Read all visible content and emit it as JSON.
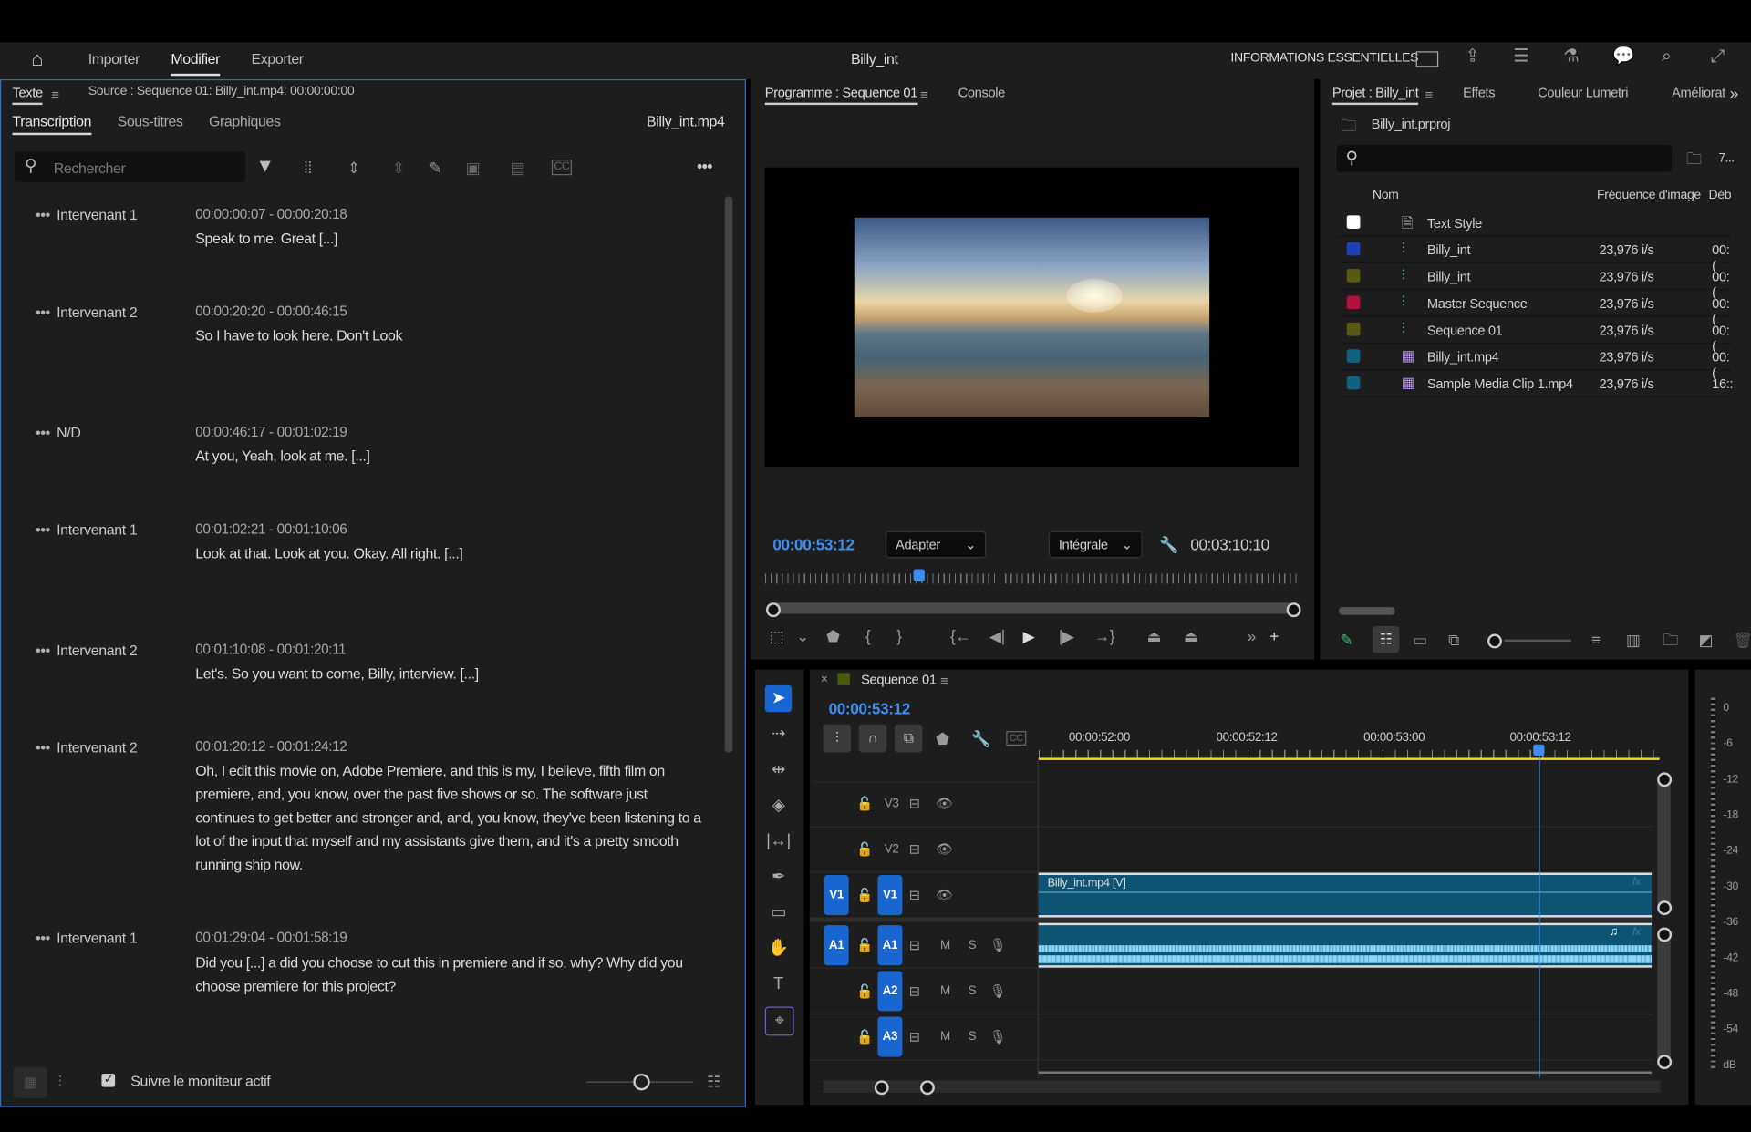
{
  "menu": {
    "items": [
      "Importer",
      "Modifier",
      "Exporter"
    ],
    "active": "Modifier",
    "title": "Billy_int",
    "workspace": "INFORMATIONS ESSENTIELLES"
  },
  "text_panel": {
    "title": "Texte",
    "source": "Source : Sequence 01: Billy_int.mp4: 00:00:00:00",
    "tabs": [
      "Transcription",
      "Sous-titres",
      "Graphiques"
    ],
    "clip": "Billy_int.mp4",
    "search_placeholder": "Rechercher",
    "follow_label": "Suivre le moniteur actif",
    "follow_checked": true,
    "entries": [
      {
        "speaker": "Intervenant 1",
        "time": "00:00:00:07 - 00:00:20:18",
        "text": "Speak to me. Great [...]"
      },
      {
        "speaker": "Intervenant 2",
        "time": "00:00:20:20 - 00:00:46:15",
        "text": "So I have to look here. Don't Look"
      },
      {
        "speaker": "N/D",
        "time": "00:00:46:17 - 00:01:02:19",
        "text": "At you, Yeah, look at me. [...]"
      },
      {
        "speaker": "Intervenant 1",
        "time": "00:01:02:21 - 00:01:10:06",
        "text": "Look at that. Look at you. Okay. All right. [...]"
      },
      {
        "speaker": "Intervenant 2",
        "time": "00:01:10:08 - 00:01:20:11",
        "text": "Let's. So you want to come, Billy, interview. [...]"
      },
      {
        "speaker": "Intervenant 2",
        "time": "00:01:20:12 - 00:01:24:12",
        "text": "Oh, I edit this movie on, Adobe Premiere, and this is my, I believe, fifth film on premiere, and, you know, over the past five shows or so. The software just continues to get better and stronger and, and, you know, they've been listening to a lot of the input that myself and my assistants give them, and it's a pretty smooth running ship now."
      },
      {
        "speaker": "Intervenant 1",
        "time": "00:01:29:04 - 00:01:58:19",
        "text": "Did you [...] a did you choose to cut this in premiere and if so, why? Why did you choose premiere for this project?"
      }
    ]
  },
  "program": {
    "tabs": [
      "Programme : Sequence 01",
      "Console"
    ],
    "timecode": "00:00:53:12",
    "fit": "Adapter",
    "quality": "Intégrale",
    "duration": "00:03:10:10",
    "playhead_fraction": 0.28
  },
  "project": {
    "tabs": [
      "Projet : Billy_int",
      "Effets",
      "Couleur Lumetri",
      "Améliorat"
    ],
    "file": "Billy_int.prproj",
    "count": "7...",
    "columns": [
      "Nom",
      "Fréquence d'image",
      "Déb"
    ],
    "items": [
      {
        "name": "Text Style",
        "color": "#ffffff",
        "icon": "pr-file-icon",
        "fps": "",
        "start": ""
      },
      {
        "name": "Billy_int",
        "color": "#1f3fb8",
        "icon": "sequence-icon",
        "fps": "23,976 i/s",
        "start": "00:("
      },
      {
        "name": "Billy_int",
        "color": "#5a5a12",
        "icon": "sequence-icon",
        "fps": "23,976 i/s",
        "start": "00:("
      },
      {
        "name": "Master Sequence",
        "color": "#b0103a",
        "icon": "sequence-icon",
        "fps": "23,976 i/s",
        "start": "00:("
      },
      {
        "name": "Sequence 01",
        "color": "#5a5a12",
        "icon": "sequence-icon",
        "fps": "23,976 i/s",
        "start": "00:("
      },
      {
        "name": "Billy_int.mp4",
        "color": "#0e5f80",
        "icon": "clip-icon",
        "fps": "23,976 i/s",
        "start": "00:("
      },
      {
        "name": "Sample Media Clip 1.mp4",
        "color": "#0e5f80",
        "icon": "clip-icon",
        "fps": "23,976 i/s",
        "start": "16::"
      }
    ]
  },
  "timeline": {
    "name": "Sequence 01",
    "timecode": "00:00:53:12",
    "ruler": [
      "00:00:52:00",
      "00:00:52:12",
      "00:00:53:00",
      "00:00:53:12"
    ],
    "tracks": {
      "video": [
        "V3",
        "V2",
        "V1"
      ],
      "audio": [
        "A1",
        "A2",
        "A3"
      ],
      "source_v": "V1",
      "source_a": "A1"
    },
    "clip_label": "Billy_int.mp4 [V]",
    "mute": "M",
    "solo": "S"
  },
  "meter": {
    "labels": [
      "0",
      "-6",
      "-12",
      "-18",
      "-24",
      "-30",
      "-36",
      "-42",
      "-48",
      "-54",
      "dB"
    ]
  }
}
